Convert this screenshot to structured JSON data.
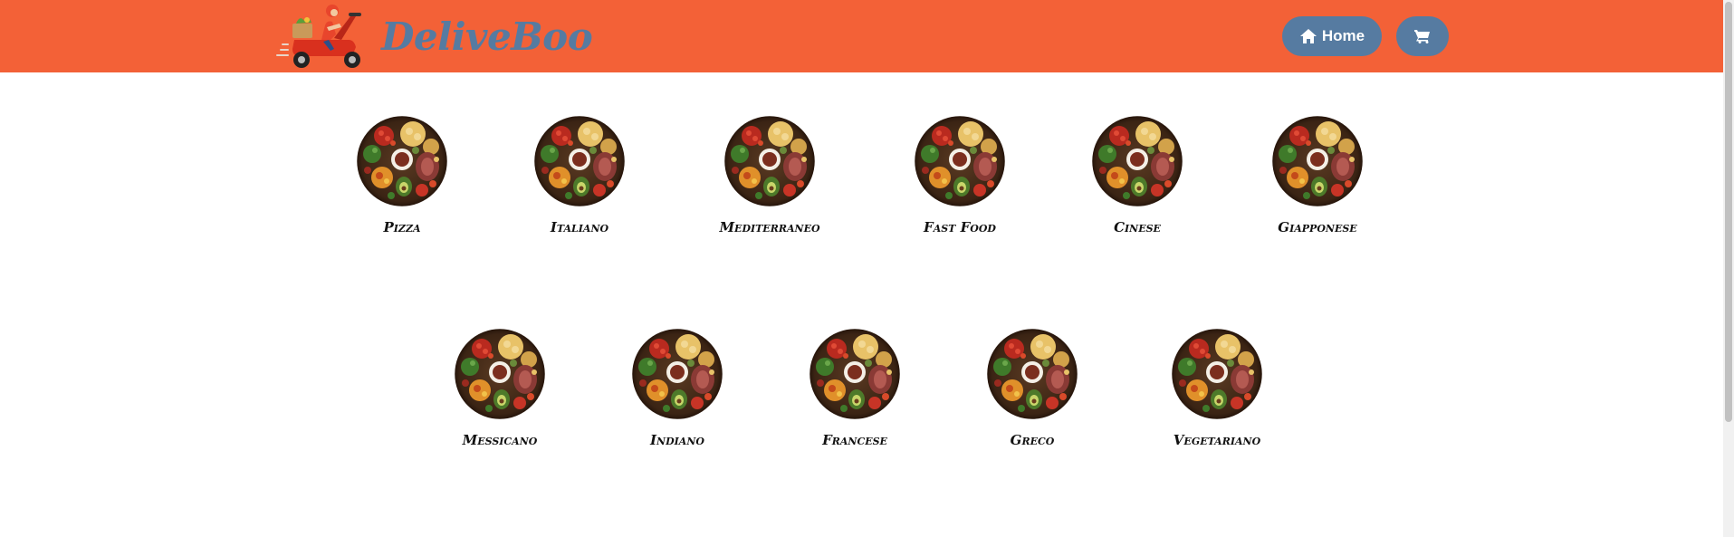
{
  "header": {
    "brand": "DeliveBoo",
    "logo_icon": "delivery-scooter-logo",
    "home_label": "Home",
    "home_icon": "home-icon",
    "cart_icon": "cart-icon",
    "background": "#f36137",
    "button_color": "#567ba1"
  },
  "categories": [
    {
      "label": "Pizza"
    },
    {
      "label": "Italiano"
    },
    {
      "label": "Mediterraneo"
    },
    {
      "label": "Fast Food"
    },
    {
      "label": "Cinese"
    },
    {
      "label": "Giapponese"
    },
    {
      "label": "Messicano"
    },
    {
      "label": "Indiano"
    },
    {
      "label": "Francese"
    },
    {
      "label": "Greco"
    },
    {
      "label": "Vegetariano"
    }
  ]
}
